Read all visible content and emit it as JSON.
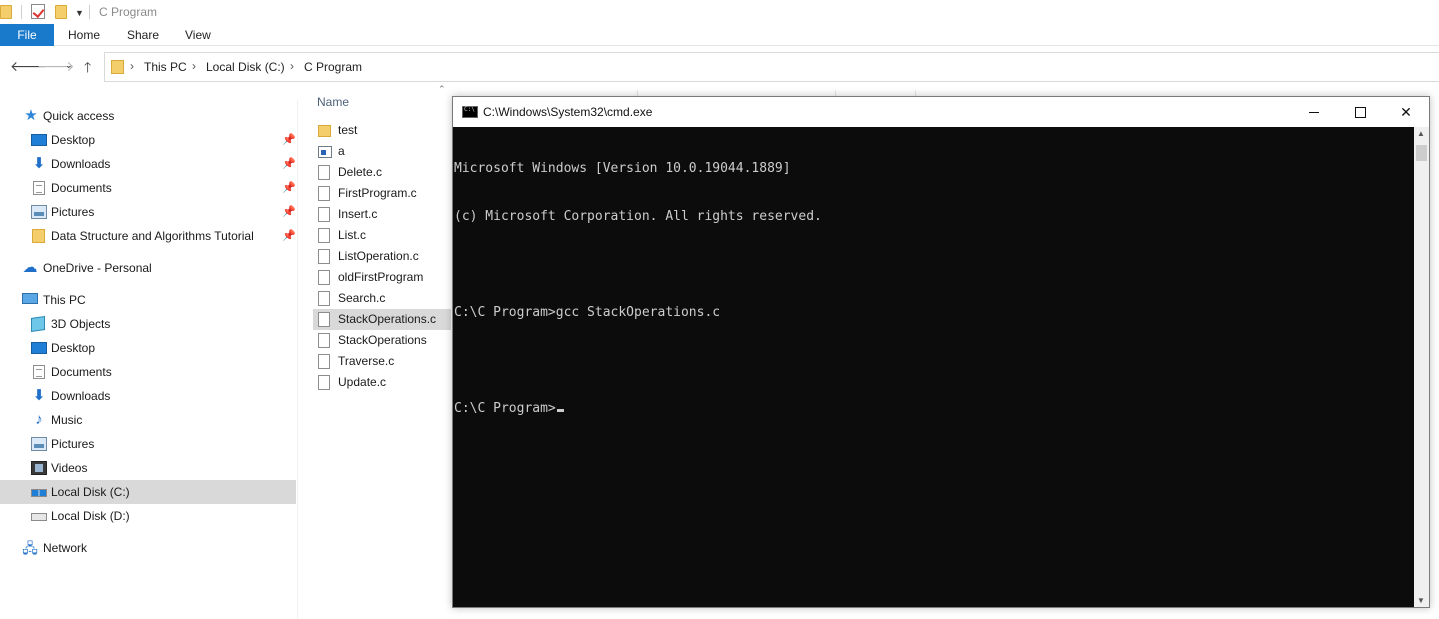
{
  "explorer": {
    "title": "C Program",
    "ribbon_tabs": [
      "File",
      "Home",
      "Share",
      "View"
    ],
    "breadcrumb": [
      "This PC",
      "Local Disk (C:)",
      "C Program"
    ],
    "column_header": "Name"
  },
  "navpane": {
    "quick_access": "Quick access",
    "quick_items": [
      "Desktop",
      "Downloads",
      "Documents",
      "Pictures",
      "Data Structure and Algorithms Tutorial"
    ],
    "onedrive": "OneDrive - Personal",
    "this_pc": "This PC",
    "pc_items": [
      "3D Objects",
      "Desktop",
      "Documents",
      "Downloads",
      "Music",
      "Pictures",
      "Videos",
      "Local Disk (C:)",
      "Local Disk (D:)"
    ],
    "network": "Network",
    "selected": "Local Disk (C:)"
  },
  "files": [
    {
      "name": "test",
      "type": "folder"
    },
    {
      "name": "a",
      "type": "exe"
    },
    {
      "name": "Delete.c",
      "type": "file"
    },
    {
      "name": "FirstProgram.c",
      "type": "file"
    },
    {
      "name": "Insert.c",
      "type": "file"
    },
    {
      "name": "List.c",
      "type": "file"
    },
    {
      "name": "ListOperation.c",
      "type": "file"
    },
    {
      "name": "oldFirstProgram",
      "type": "file"
    },
    {
      "name": "Search.c",
      "type": "file"
    },
    {
      "name": "StackOperations.c",
      "type": "file",
      "selected": true
    },
    {
      "name": "StackOperations",
      "type": "file"
    },
    {
      "name": "Traverse.c",
      "type": "file"
    },
    {
      "name": "Update.c",
      "type": "file"
    }
  ],
  "cmd": {
    "title": "C:\\Windows\\System32\\cmd.exe",
    "lines": [
      "Microsoft Windows [Version 10.0.19044.1889]",
      "(c) Microsoft Corporation. All rights reserved.",
      "",
      "C:\\C Program>gcc StackOperations.c",
      "",
      "C:\\C Program>"
    ]
  },
  "colors": {
    "file_tab": "#1979ca",
    "console_bg": "#0c0c0c",
    "console_text": "#cccccc",
    "selection": "#d9d9d9"
  }
}
